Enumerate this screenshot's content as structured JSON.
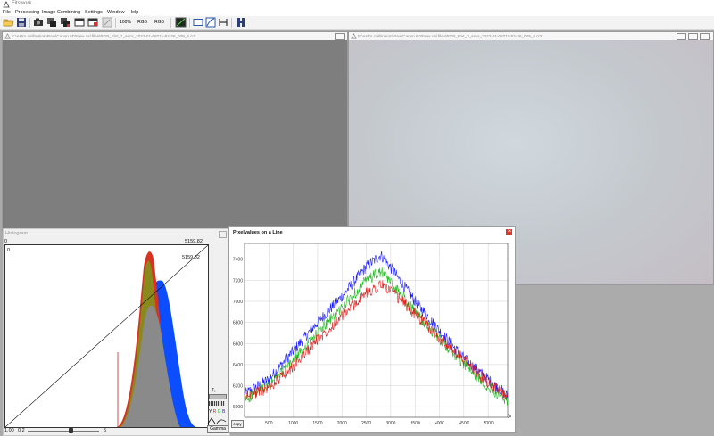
{
  "app": {
    "title": "Fitswork"
  },
  "menu": [
    "File",
    "Processing",
    "Image Combining",
    "Settings",
    "Window",
    "Help"
  ],
  "toolbar": {
    "zoom_label": "100%",
    "rgb1_label": "RGB",
    "rgb2_label": "RGB"
  },
  "windows": {
    "left_image": {
      "title": "E:\\Astro calibration\\Raw\\Canon 6D\\New cal files\\RGB_Flat_1_secs_2022-01-06T11-52-26_009_4.cr2"
    },
    "right_image": {
      "title": "E:\\Astro calibration\\Raw\\Canon 6D\\New cal files\\RGB_Flat_1_secs_2022-01-06T11-52-26_009_4.cr2"
    },
    "histogram": {
      "title": "Histogram",
      "left_min": "0",
      "top_right": "5159.82",
      "inner_left": "0",
      "inner_right": "5159.82",
      "gamma_value": "1.00",
      "slider_value": "0.2",
      "slider_max": "5",
      "gamma_button": "Gamma",
      "rgb_letters": [
        "Y",
        "R",
        "G",
        "B"
      ],
      "t_label": "T₁",
      "slider_fraction": 0.6
    },
    "pixel_line": {
      "title": "Pixelvalues on a Line",
      "copy_label": "copy",
      "x_axis_label": "X"
    }
  },
  "colors": {
    "red": "#e02020",
    "green": "#22bb22",
    "blue": "#1a1aff",
    "close": "#d8372b"
  },
  "chart_data": {
    "type": "line",
    "title": "Pixelvalues on a Line",
    "xlabel": "X",
    "ylabel": "",
    "xlim": [
      0,
      5400
    ],
    "ylim": [
      5900,
      7550
    ],
    "xticks": [
      500,
      1000,
      1500,
      2000,
      2500,
      3000,
      3500,
      4000,
      4500,
      5000
    ],
    "yticks": [
      6000,
      6200,
      6400,
      6600,
      6800,
      7000,
      7200,
      7400
    ],
    "grid": true,
    "series": [
      {
        "color": "#1a1aff",
        "x": [
          0,
          500,
          1000,
          1500,
          2000,
          2500,
          2800,
          3000,
          3500,
          4000,
          4500,
          5000,
          5400
        ],
        "y": [
          6120,
          6260,
          6530,
          6800,
          7050,
          7330,
          7440,
          7320,
          7000,
          6720,
          6460,
          6260,
          6100
        ]
      },
      {
        "color": "#22bb22",
        "x": [
          0,
          500,
          1000,
          1500,
          2000,
          2500,
          2800,
          3000,
          3500,
          4000,
          4500,
          5000,
          5400
        ],
        "y": [
          6070,
          6200,
          6440,
          6700,
          6940,
          7200,
          7280,
          7180,
          6900,
          6640,
          6400,
          6190,
          6060
        ]
      },
      {
        "color": "#e02020",
        "x": [
          0,
          500,
          1000,
          1500,
          2000,
          2500,
          2800,
          3000,
          3500,
          4000,
          4500,
          5000,
          5400
        ],
        "y": [
          6090,
          6180,
          6380,
          6640,
          6860,
          7080,
          7160,
          7100,
          6880,
          6650,
          6440,
          6230,
          6080
        ]
      }
    ]
  }
}
